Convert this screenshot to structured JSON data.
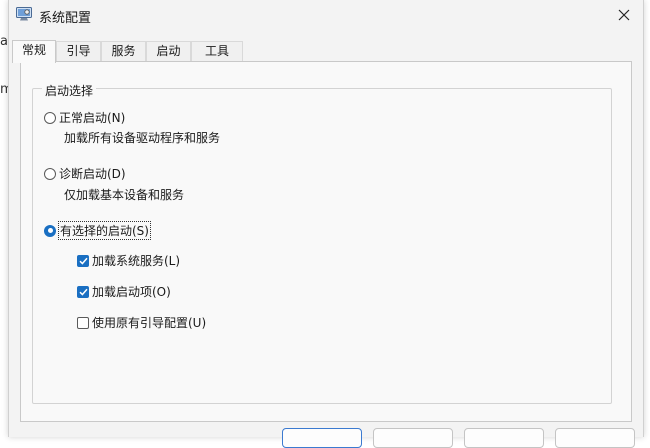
{
  "background": {
    "glyph_a": "a",
    "glyph_m": "m"
  },
  "window": {
    "title": "系统配置",
    "close_symbol": "✕"
  },
  "tabs": [
    {
      "label": "常规",
      "active": true
    },
    {
      "label": "引导",
      "active": false
    },
    {
      "label": "服务",
      "active": false
    },
    {
      "label": "启动",
      "active": false
    },
    {
      "label": "工具",
      "active": false
    }
  ],
  "startup_selection": {
    "legend": "启动选择",
    "normal": {
      "label": "正常启动(N)",
      "description": "加载所有设备驱动程序和服务",
      "checked": false
    },
    "diagnostic": {
      "label": "诊断启动(D)",
      "description": "仅加载基本设备和服务",
      "checked": false
    },
    "selective": {
      "label": "有选择的启动(S)",
      "checked": true
    },
    "options": [
      {
        "label": "加载系统服务(L)",
        "checked": true
      },
      {
        "label": "加载启动项(O)",
        "checked": true
      },
      {
        "label": "使用原有引导配置(U)",
        "checked": false
      }
    ]
  },
  "colors": {
    "accent": "#1a6fc2",
    "window_bg": "#f3f3f3",
    "panel_bg": "#f9f9f9"
  }
}
